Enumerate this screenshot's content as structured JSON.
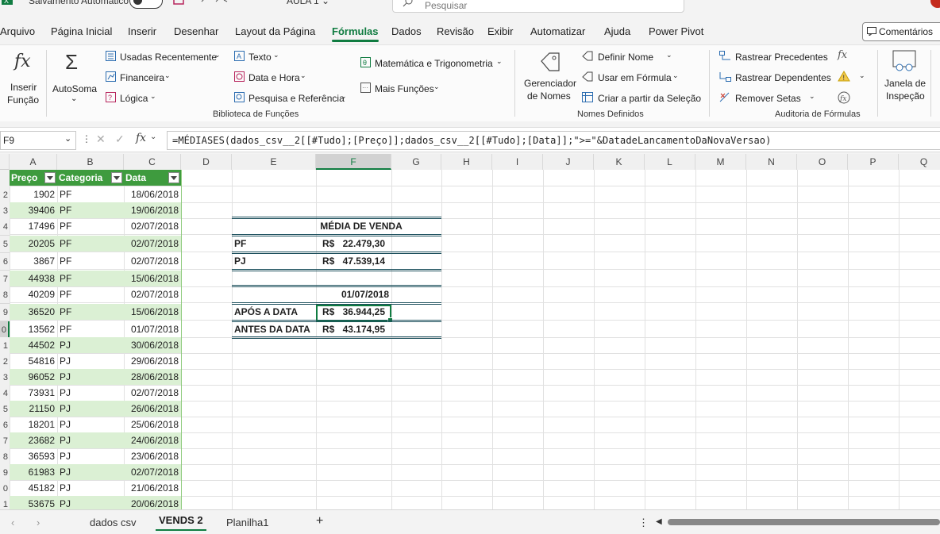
{
  "titlebar": {
    "autosave": "Salvamento Automático",
    "filename": "AULA 1 ⌄",
    "search_placeholder": "Pesquisar"
  },
  "menu": [
    "Arquivo",
    "Página Inicial",
    "Inserir",
    "Desenhar",
    "Layout da Página",
    "Fórmulas",
    "Dados",
    "Revisão",
    "Exibir",
    "Automatizar",
    "Ajuda",
    "Power Pivot"
  ],
  "menu_active": "Fórmulas",
  "comments_label": "Comentários",
  "ribbon": {
    "insert_function": [
      "Inserir",
      "Função"
    ],
    "autosum": "AutoSoma",
    "recent": "Usadas Recentemente",
    "financial": "Financeira",
    "logical": "Lógica",
    "text": "Texto",
    "datetime": "Data e Hora",
    "lookup": "Pesquisa e Referência",
    "math": "Matemática e Trigonometria",
    "more": "Mais Funções",
    "library_label": "Biblioteca de Funções",
    "name_manager": [
      "Gerenciador",
      "de Nomes"
    ],
    "define_name": "Definir Nome",
    "use_in_formula": "Usar em Fórmula",
    "create_from_selection": "Criar a partir da Seleção",
    "names_label": "Nomes Definidos",
    "trace_precedents": "Rastrear Precedentes",
    "trace_dependents": "Rastrear Dependentes",
    "remove_arrows": "Remover Setas",
    "watch_window": [
      "Janela de",
      "Inspeção"
    ],
    "audit_label": "Auditoria de Fórmulas"
  },
  "formula_bar": {
    "name_box": "F9",
    "formula": "=MÉDIASES(dados_csv__2[[#Tudo];[Preço]];dados_csv__2[[#Tudo];[Data]];\">=\"&DatadeLancamentoDaNovaVersao)"
  },
  "columns": [
    "A",
    "B",
    "C",
    "D",
    "E",
    "F",
    "G",
    "H",
    "I",
    "J",
    "K",
    "L",
    "M",
    "N",
    "O",
    "P",
    "Q"
  ],
  "row_numbers": [
    "",
    "2",
    "3",
    "4",
    "5",
    "6",
    "7",
    "8",
    "9",
    "0",
    "1",
    "2",
    "3",
    "4",
    "5",
    "6",
    "7",
    "8",
    "9",
    "0",
    "1"
  ],
  "table": {
    "headers": [
      "Preço",
      "Categoria",
      "Data"
    ],
    "rows": [
      [
        "1902",
        "PF",
        "18/06/2018"
      ],
      [
        "39406",
        "PF",
        "19/06/2018"
      ],
      [
        "17496",
        "PF",
        "02/07/2018"
      ],
      [
        "20205",
        "PF",
        "02/07/2018"
      ],
      [
        "3867",
        "PF",
        "02/07/2018"
      ],
      [
        "44938",
        "PF",
        "15/06/2018"
      ],
      [
        "40209",
        "PF",
        "02/07/2018"
      ],
      [
        "36520",
        "PF",
        "15/06/2018"
      ],
      [
        "13562",
        "PF",
        "01/07/2018"
      ],
      [
        "44502",
        "PJ",
        "30/06/2018"
      ],
      [
        "54816",
        "PJ",
        "29/06/2018"
      ],
      [
        "96052",
        "PJ",
        "28/06/2018"
      ],
      [
        "73931",
        "PJ",
        "02/07/2018"
      ],
      [
        "21150",
        "PJ",
        "26/06/2018"
      ],
      [
        "18201",
        "PJ",
        "25/06/2018"
      ],
      [
        "23682",
        "PJ",
        "24/06/2018"
      ],
      [
        "36593",
        "PJ",
        "23/06/2018"
      ],
      [
        "61983",
        "PJ",
        "02/07/2018"
      ],
      [
        "45182",
        "PJ",
        "21/06/2018"
      ],
      [
        "53675",
        "PJ",
        "20/06/2018"
      ]
    ]
  },
  "summary": {
    "title": "MÉDIA DE VENDA",
    "pf_label": "PF",
    "pf_currency": "R$",
    "pf_value": "22.479,30",
    "pj_label": "PJ",
    "pj_currency": "R$",
    "pj_value": "47.539,14",
    "date": "01/07/2018",
    "after_label": "APÓS A DATA",
    "after_currency": "R$",
    "after_value": "36.944,25",
    "before_label": "ANTES DA DATA",
    "before_currency": "R$",
    "before_value": "43.174,95"
  },
  "sheets": [
    "dados csv",
    "VENDS 2",
    "Planilha1"
  ],
  "active_sheet": "VENDS 2",
  "colors": {
    "accent": "#107c41",
    "table_header": "#3e9b3e",
    "band": "#dbf0d4"
  }
}
